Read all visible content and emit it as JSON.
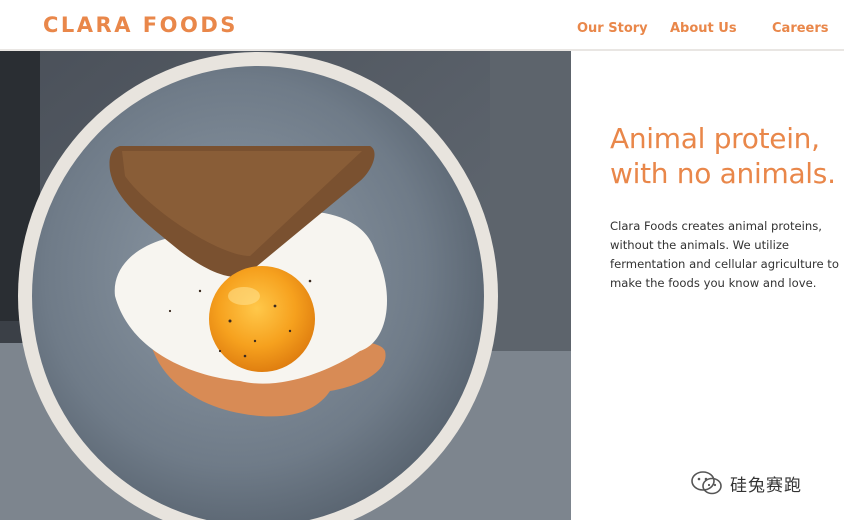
{
  "header": {
    "brand": "CLARA FOODS",
    "nav": {
      "our_story": "Our Story",
      "about_us": "About Us",
      "careers": "Careers"
    }
  },
  "hero": {
    "image_subject": "fried egg on toast in a grey bowl"
  },
  "panel": {
    "headline_line1": "Animal protein,",
    "headline_line2": "with no animals.",
    "body_line1": "Clara Foods creates animal proteins,",
    "body_line2": "without the animals. We utilize",
    "body_line3": "fermentation and cellular agriculture to",
    "body_line4": "make the foods you know and love."
  },
  "watermark": {
    "text": "硅兔赛跑"
  },
  "colors": {
    "accent": "#e9874a",
    "text": "#333333",
    "background": "#ffffff"
  }
}
